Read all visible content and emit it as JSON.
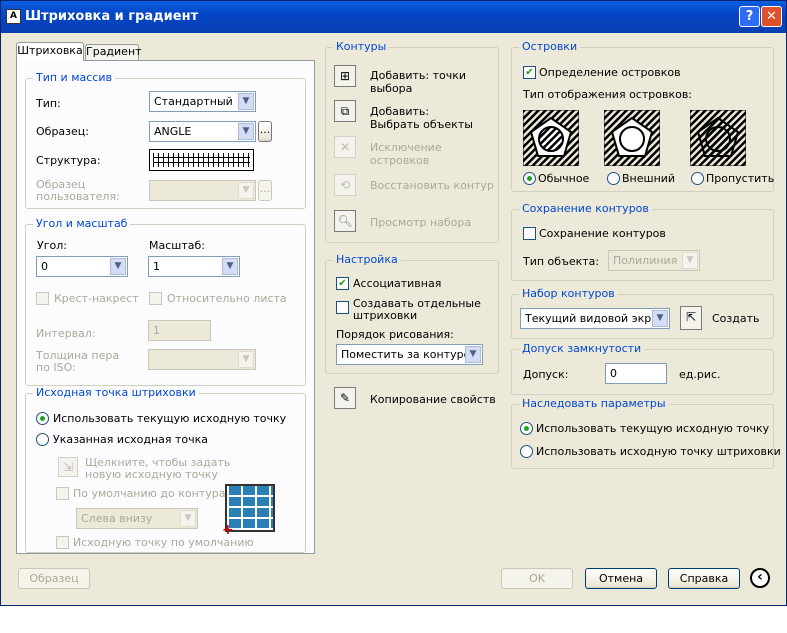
{
  "window": {
    "title": "Штриховка и градиент",
    "help": "?",
    "close": "✕"
  },
  "tabs": [
    "Штриховка",
    "Градиент"
  ],
  "type_group": {
    "title": "Тип и массив",
    "type_label": "Тип:",
    "type_value": "Стандартный",
    "pattern_label": "Образец:",
    "pattern_value": "ANGLE",
    "pattern_btn": "...",
    "structure_label": "Структура:",
    "custom_label": "Образец пользователя:"
  },
  "angle_group": {
    "title": "Угол и масштаб",
    "angle_label": "Угол:",
    "angle_value": "0",
    "scale_label": "Масштаб:",
    "scale_value": "1",
    "cross_label": "Крест-накрест",
    "relative_label": "Относительно листа",
    "interval_label": "Интервал:",
    "interval_value": "1",
    "pen_label": "Толщина пера по ISO:"
  },
  "origin_group": {
    "title": "Исходная точка штриховки",
    "use_current": "Использовать текущую исходную точку",
    "specified": "Указанная исходная точка",
    "click_hint": "Щелкните, чтобы задать новую исходную точку",
    "default_contour": "По умолчанию до контура",
    "position_value": "Слева внизу",
    "store_default": "Исходную точку по умолчанию"
  },
  "contours": {
    "title": "Контуры",
    "add_points": "Добавить: точки выбора",
    "add_objects": "Добавить: Выбрать объекты",
    "remove_islands": "Исключение островков",
    "recreate": "Восстановить контур",
    "view": "Просмотр набора"
  },
  "settings": {
    "title": "Настройка",
    "associative": "Ассоциативная",
    "separate": "Создавать отдельные штриховки",
    "draw_order_label": "Порядок рисования:",
    "draw_order_value": "Поместить за контуром"
  },
  "inherit_props": "Копирование свойств",
  "islands": {
    "title": "Островки",
    "detect": "Определение островков",
    "display_label": "Тип отображения островков:",
    "normal": "Обычное",
    "outer": "Внешний",
    "ignore": "Пропустить"
  },
  "retain": {
    "title": "Сохранение контуров",
    "retain_label": "Сохранение контуров",
    "object_label": "Тип объекта:",
    "object_value": "Полилиния"
  },
  "boundary_set": {
    "title": "Набор контуров",
    "value": "Текущий видовой экран",
    "new_label": "Создать"
  },
  "gap": {
    "title": "Допуск замкнутости",
    "label": "Допуск:",
    "value": "0",
    "unit": "ед.рис."
  },
  "inherit_options": {
    "title": "Наследовать параметры",
    "current": "Использовать текущую исходную точку",
    "source": "Использовать исходную точку штриховки"
  },
  "footer": {
    "preview": "Образец",
    "ok": "OK",
    "cancel": "Отмена",
    "help": "Справка",
    "more": "‹"
  }
}
